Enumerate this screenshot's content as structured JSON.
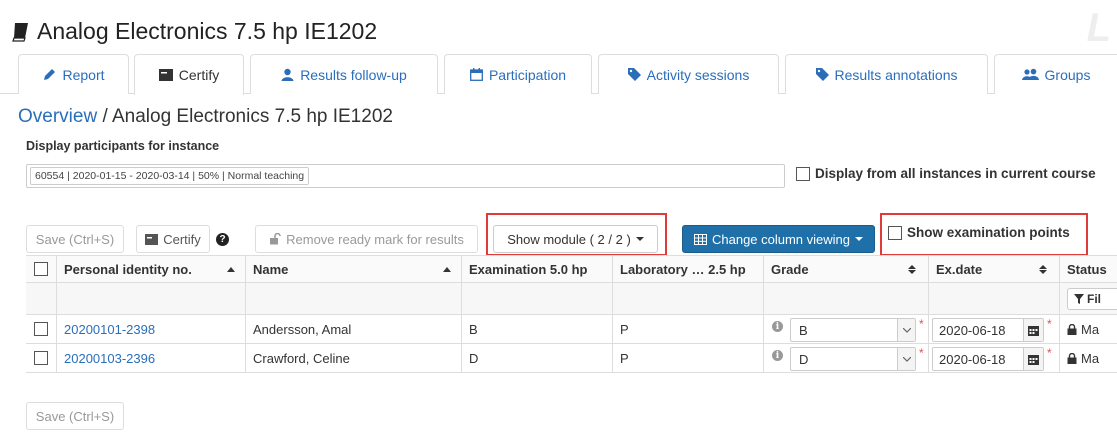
{
  "course": {
    "title": "Analog Electronics 7.5 hp IE1202",
    "watermark": "L"
  },
  "tabs": [
    {
      "label": "Report",
      "icon": "pencil-icon",
      "active": false
    },
    {
      "label": "Certify",
      "icon": "certificate-icon",
      "active": true
    },
    {
      "label": "Results follow-up",
      "icon": "user-icon",
      "active": false
    },
    {
      "label": "Participation",
      "icon": "calendar-icon",
      "active": false
    },
    {
      "label": "Activity sessions",
      "icon": "tag-icon",
      "active": false
    },
    {
      "label": "Results annotations",
      "icon": "tag-icon",
      "active": false
    },
    {
      "label": "Groups",
      "icon": "users-icon",
      "active": false
    }
  ],
  "breadcrumb": {
    "overview": "Overview",
    "separator": " / ",
    "current": "Analog Electronics 7.5 hp IE1202"
  },
  "instance": {
    "label": "Display participants for instance",
    "selected": "60554 | 2020-01-15 - 2020-03-14 | 50% | Normal teaching",
    "display_all_label": "Display from all instances in current course"
  },
  "toolbar": {
    "save_label": "Save (Ctrl+S)",
    "certify_label": "Certify",
    "remove_ready_label": "Remove ready mark for results",
    "show_module_label": "Show module ( 2 / 2 )",
    "change_column_label": "Change column viewing",
    "show_exam_points_label": "Show examination points"
  },
  "table": {
    "columns": [
      "Personal identity no.",
      "Name",
      "Examination 5.0 hp",
      "Laboratory … 2.5 hp",
      "Grade",
      "Ex.date",
      "Status"
    ],
    "filter_label": "Fil",
    "rows": [
      {
        "id": "20200101-2398",
        "name": "Andersson, Amal",
        "exam": "B",
        "lab": "P",
        "grade": "B",
        "date": "2020-06-18",
        "status": "Ma"
      },
      {
        "id": "20200103-2396",
        "name": "Crawford, Celine",
        "exam": "D",
        "lab": "P",
        "grade": "D",
        "date": "2020-06-18",
        "status": "Ma"
      }
    ]
  },
  "footer": {
    "save_label": "Save (Ctrl+S)"
  },
  "colors": {
    "link": "#2a6ebb",
    "primary": "#1f6fa8",
    "highlight": "#e03a3a"
  }
}
